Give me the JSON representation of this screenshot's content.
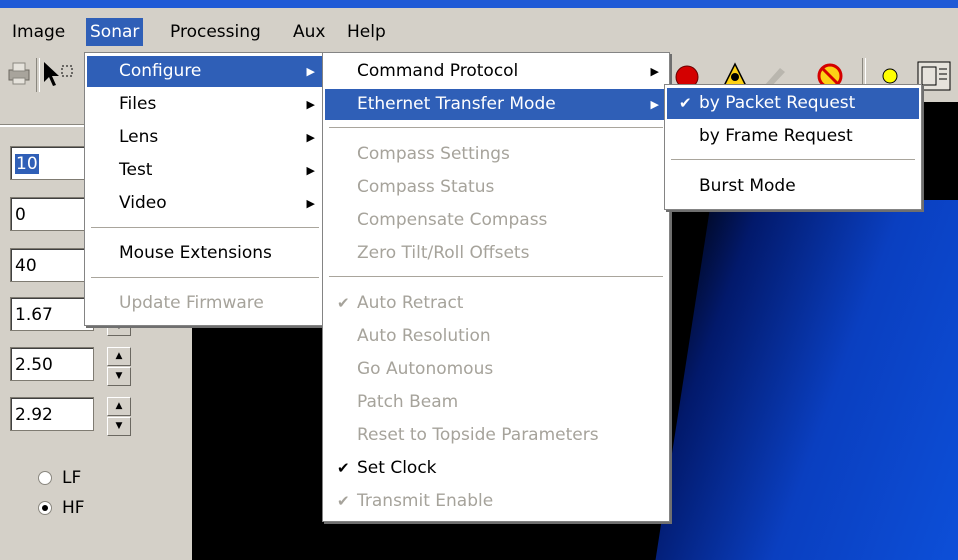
{
  "menubar": {
    "items": [
      "Image",
      "Sonar",
      "Processing",
      "Aux",
      "Help"
    ]
  },
  "sonar_menu": {
    "items": [
      {
        "label": "Configure",
        "submenu": true,
        "enabled": true,
        "highlighted": true
      },
      {
        "label": "Files",
        "submenu": true,
        "enabled": true
      },
      {
        "label": "Lens",
        "submenu": true,
        "enabled": true
      },
      {
        "label": "Test",
        "submenu": true,
        "enabled": true
      },
      {
        "label": "Video",
        "submenu": true,
        "enabled": true
      },
      {
        "label": "Mouse Extensions",
        "submenu": false,
        "enabled": true
      },
      {
        "label": "Update Firmware",
        "submenu": false,
        "enabled": false
      }
    ]
  },
  "configure_menu": {
    "items": [
      {
        "label": "Command Protocol",
        "submenu": true,
        "enabled": true
      },
      {
        "label": "Ethernet Transfer Mode",
        "submenu": true,
        "enabled": true,
        "highlighted": true
      },
      {
        "label": "Compass Settings",
        "enabled": false
      },
      {
        "label": "Compass Status",
        "enabled": false
      },
      {
        "label": "Compensate Compass",
        "enabled": false
      },
      {
        "label": "Zero Tilt/Roll Offsets",
        "enabled": false
      },
      {
        "label": "Auto Retract",
        "enabled": false,
        "checked": true
      },
      {
        "label": "Auto Resolution",
        "enabled": false
      },
      {
        "label": "Go Autonomous",
        "enabled": false
      },
      {
        "label": "Patch Beam",
        "enabled": false
      },
      {
        "label": "Reset to Topside Parameters",
        "enabled": false
      },
      {
        "label": "Set Clock",
        "enabled": true,
        "checked": true
      },
      {
        "label": "Transmit Enable",
        "enabled": false,
        "checked": true
      }
    ]
  },
  "ethernet_menu": {
    "items": [
      {
        "label": "by Packet Request",
        "checked": true,
        "highlighted": true
      },
      {
        "label": "by Frame Request",
        "checked": false
      },
      {
        "label": "Burst Mode",
        "checked": false
      }
    ]
  },
  "left_panel": {
    "fields": [
      "10",
      "0",
      "40",
      "1.67",
      "2.50",
      "2.92"
    ],
    "radios": [
      {
        "label": "LF",
        "selected": false
      },
      {
        "label": "HF",
        "selected": true
      }
    ]
  },
  "check_glyph": "✔",
  "arrow_glyph": "▶",
  "colors": {
    "highlight": "#2f5fb7",
    "disabled_text": "#a6a39b"
  }
}
